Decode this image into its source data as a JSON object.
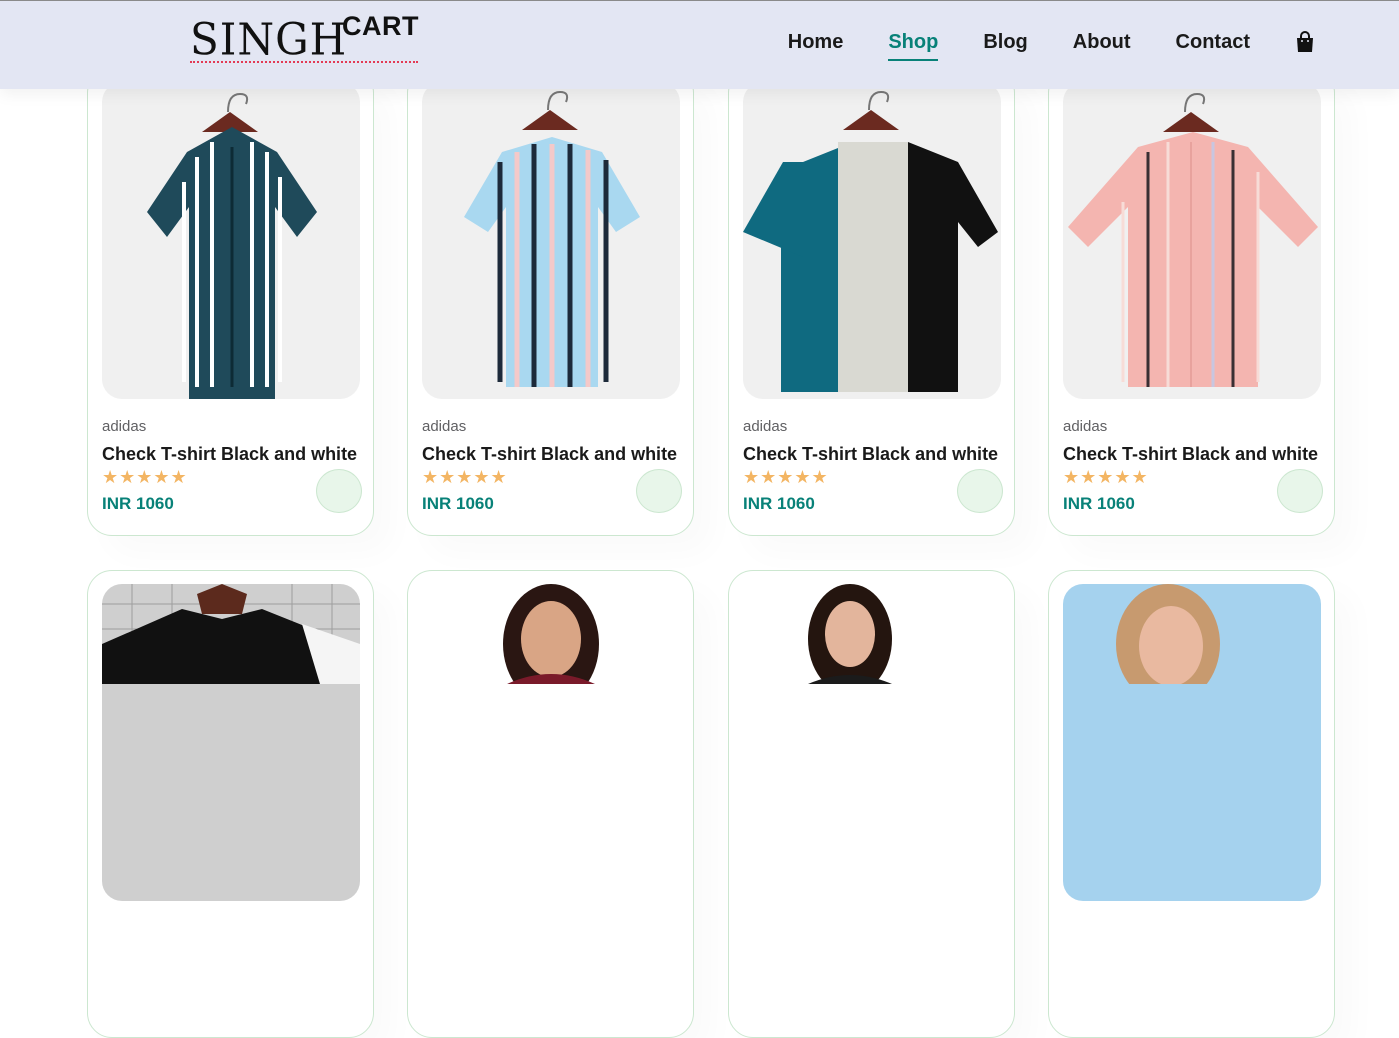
{
  "brand": {
    "logo_main": "SINGH",
    "logo_sup": "CART"
  },
  "nav": {
    "items": [
      {
        "label": "Home",
        "active": false
      },
      {
        "label": "Shop",
        "active": true
      },
      {
        "label": "Blog",
        "active": false
      },
      {
        "label": "About",
        "active": false
      },
      {
        "label": "Contact",
        "active": false
      }
    ],
    "cart_icon": "shopping-bag-icon"
  },
  "products": [
    {
      "brand": "adidas",
      "name": "Check T-shirt Black and white",
      "rating": 5,
      "price": "INR 1060",
      "image": "navy-white-striped-shirt"
    },
    {
      "brand": "adidas",
      "name": "Check T-shirt Black and white",
      "rating": 5,
      "price": "INR 1060",
      "image": "blue-striped-tshirt"
    },
    {
      "brand": "adidas",
      "name": "Check T-shirt Black and white",
      "rating": 5,
      "price": "INR 1060",
      "image": "teal-grey-black-tshirt"
    },
    {
      "brand": "adidas",
      "name": "Check T-shirt Black and white",
      "rating": 5,
      "price": "INR 1060",
      "image": "pink-striped-shirt"
    }
  ],
  "products_row2": [
    {
      "image": "black-tshirt-hanger"
    },
    {
      "image": "woman-portrait-1"
    },
    {
      "image": "woman-portrait-2"
    },
    {
      "image": "woman-blue-background"
    }
  ],
  "stars_glyph": "★★★★★",
  "cart_button_glyph": "",
  "colors": {
    "accent": "#088178",
    "star": "#f3b563",
    "header_bg": "#e3e6f3"
  }
}
